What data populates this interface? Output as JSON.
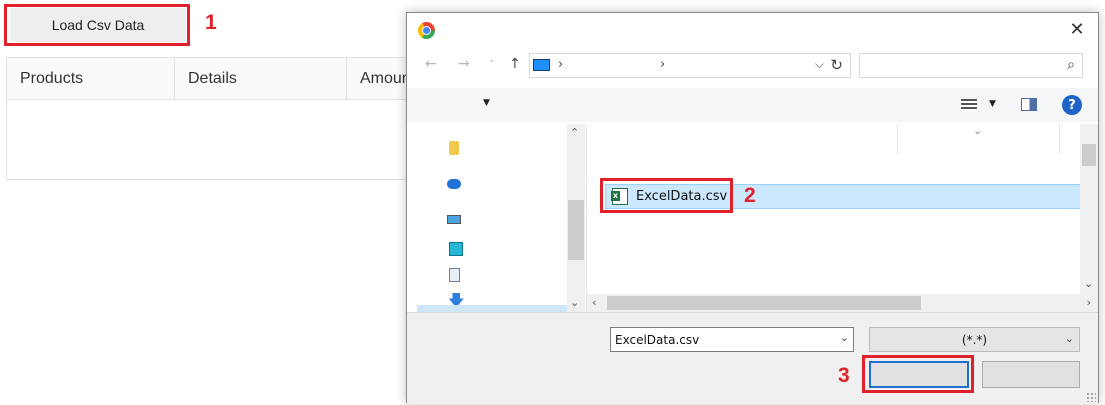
{
  "page": {
    "load_button_label": "Load Csv Data",
    "grid_columns": [
      "Products",
      "Details",
      "Amount"
    ]
  },
  "annotations": [
    {
      "number": "1",
      "target": "load-csv-button"
    },
    {
      "number": "2",
      "target": "file-item"
    },
    {
      "number": "3",
      "target": "open-button"
    }
  ],
  "dialog": {
    "close_glyph": "✕",
    "nav": {
      "back": "←",
      "forward": "→",
      "recent": "˅",
      "up": "↑"
    },
    "address": {
      "chevrons": [
        "›",
        "›"
      ],
      "dropdown": "⌵",
      "refresh": "↻"
    },
    "search_placeholder": "",
    "search_glyph": "⌕",
    "help_glyph": "?",
    "files": [
      {
        "name": "ExcelData.csv",
        "selected": true
      }
    ],
    "file_name_value": "ExcelData.csv",
    "file_type_filter": "(*.*)",
    "open_label": "",
    "cancel_label": ""
  },
  "colors": {
    "annotation_red": "#e0202a",
    "selection_blue": "#cce8ff",
    "focus_blue": "#1f6fd1"
  }
}
